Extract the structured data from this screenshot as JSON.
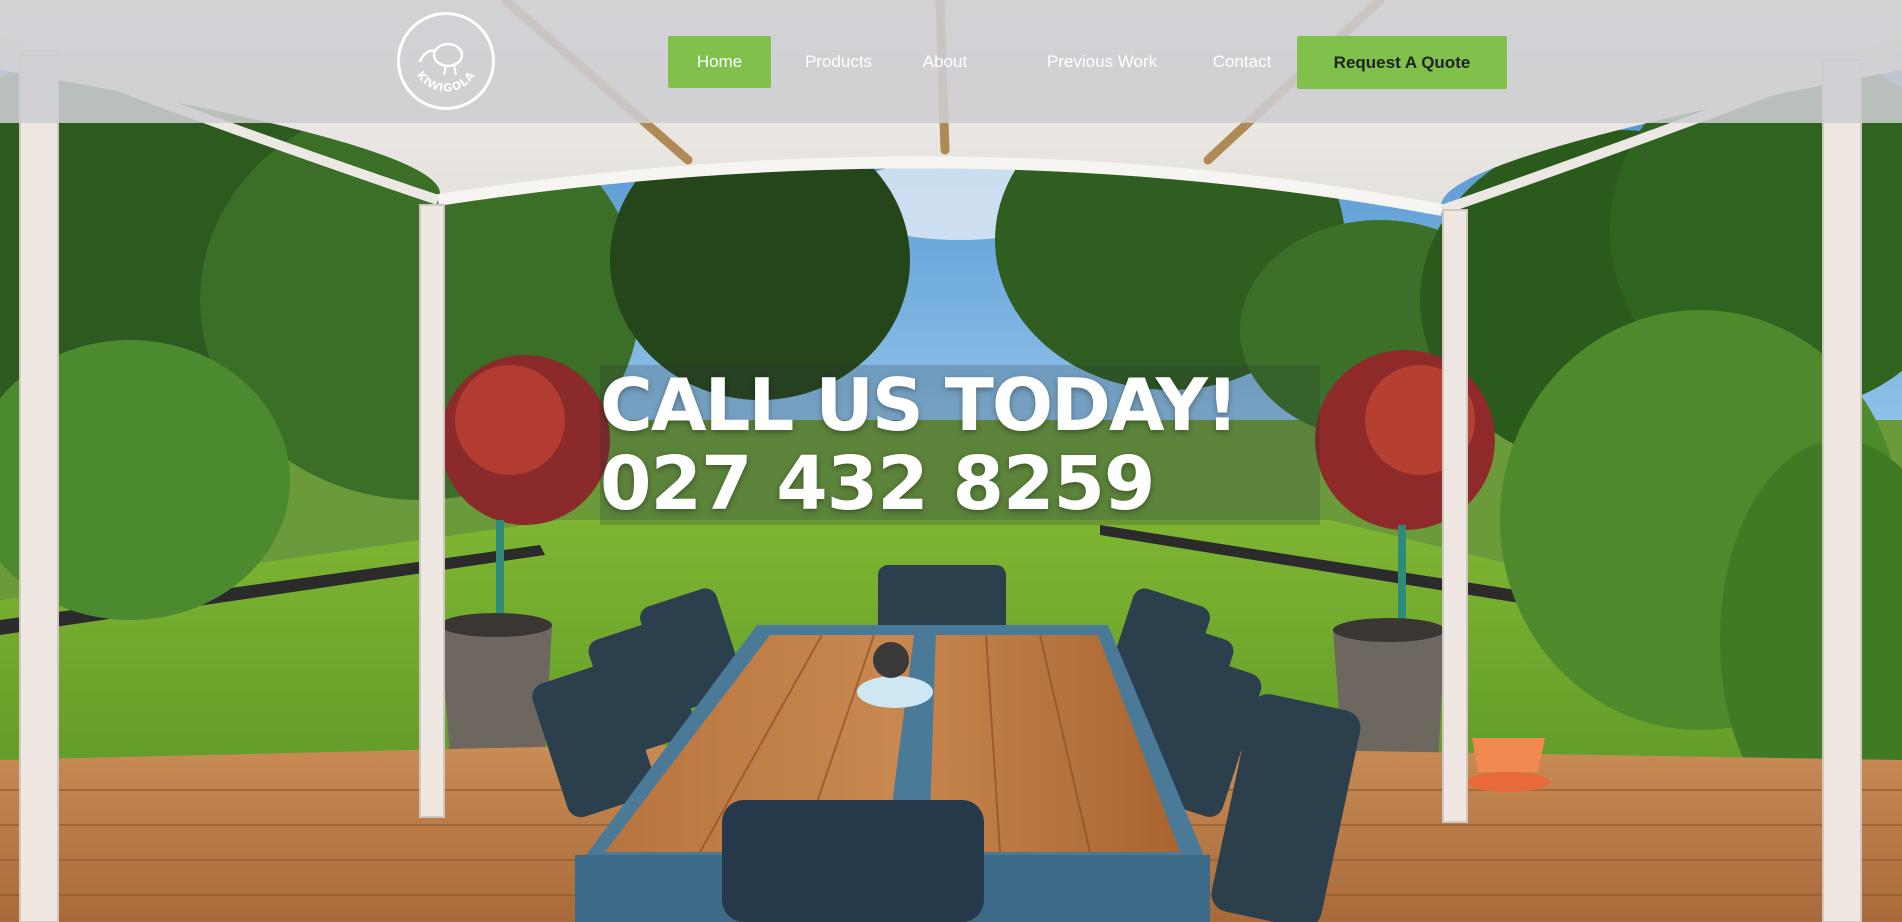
{
  "logo": {
    "text": "KIWIGOLA",
    "icon": "kiwi-bird-icon"
  },
  "nav": {
    "items": [
      {
        "label": "Home",
        "active": true
      },
      {
        "label": "Products",
        "active": false
      },
      {
        "label": "About",
        "active": false
      },
      {
        "label": "Previous Work",
        "active": false
      },
      {
        "label": "Contact",
        "active": false
      }
    ],
    "cta_label": "Request A Quote"
  },
  "hero": {
    "headline": "CALL US TODAY!",
    "phone": "027 432 8259"
  },
  "colors": {
    "accent": "#7fc14a",
    "header_bg": "#cdcdd2",
    "text_light": "#ffffff"
  }
}
